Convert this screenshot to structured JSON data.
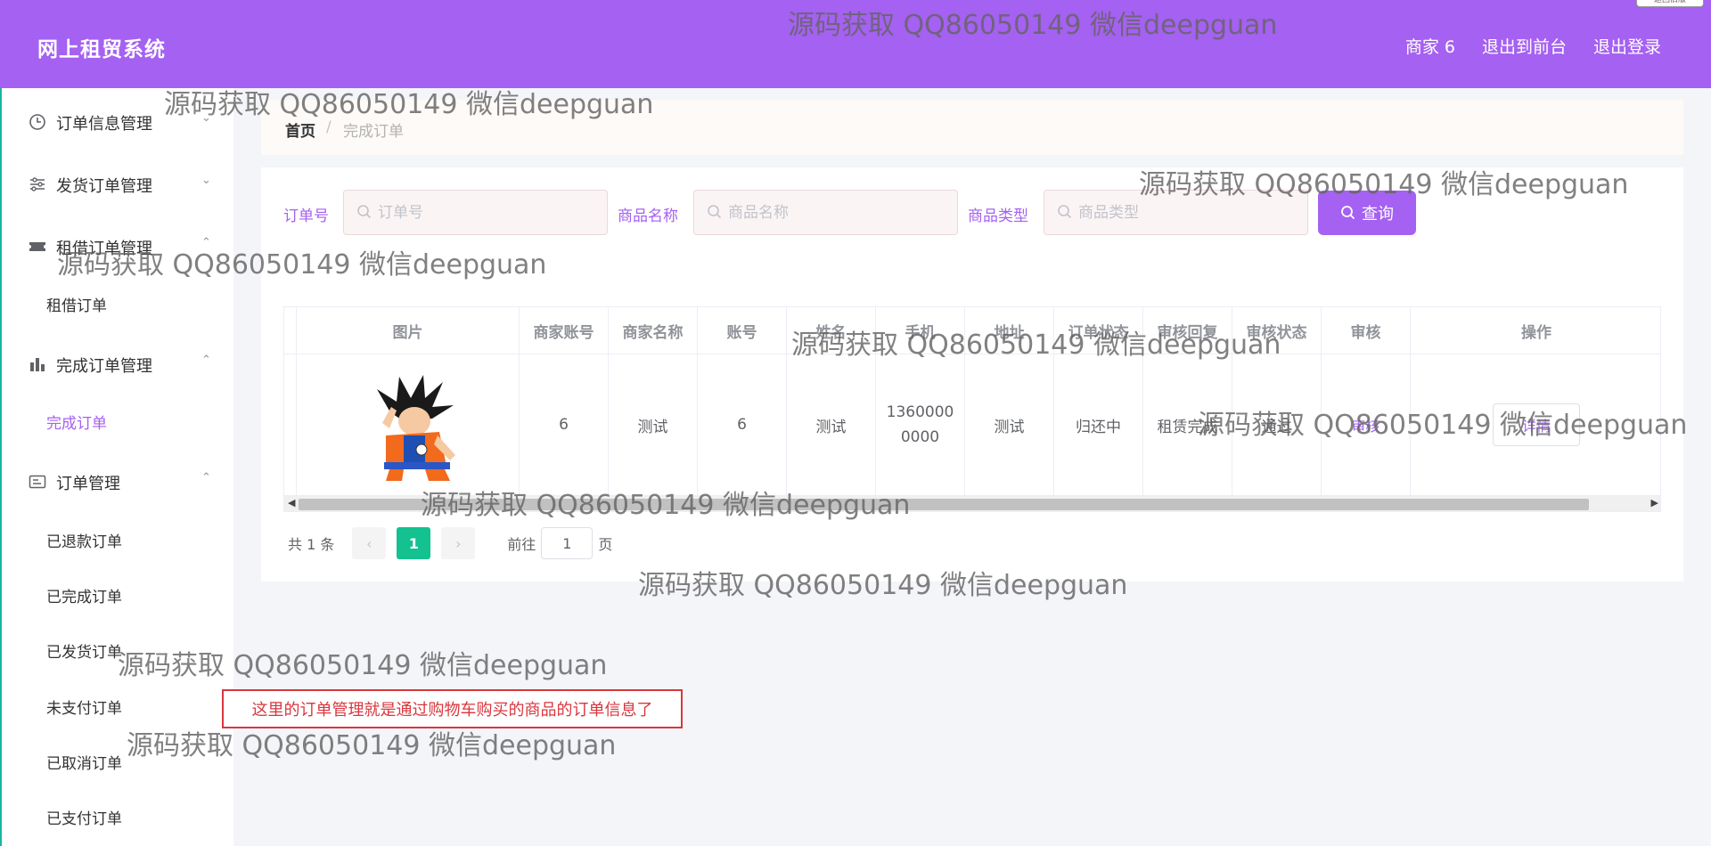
{
  "header": {
    "app_title": "网上租贸系统",
    "nav": [
      "商家 6",
      "退出到前台",
      "退出登录"
    ],
    "corner_label": "返回旧版"
  },
  "sidebar": {
    "groups": [
      {
        "label": "订单信息管理",
        "icon": "clock-icon",
        "chevron": "⌄"
      },
      {
        "label": "发货订单管理",
        "icon": "sliders-icon",
        "chevron": "⌄"
      },
      {
        "label": "租借订单管理",
        "icon": "ticket-icon",
        "chevron": "⌃",
        "items": [
          "租借订单"
        ]
      },
      {
        "label": "完成订单管理",
        "icon": "bar-chart-icon",
        "chevron": "⌃",
        "items": [
          "完成订单"
        ]
      },
      {
        "label": "订单管理",
        "icon": "id-card-icon",
        "chevron": "⌃",
        "items": [
          "已退款订单",
          "已完成订单",
          "已发货订单",
          "未支付订单",
          "已取消订单",
          "已支付订单"
        ]
      }
    ],
    "active_item": "完成订单"
  },
  "breadcrumb": {
    "home": "首页",
    "separator": "/",
    "current": "完成订单"
  },
  "search": {
    "fields": [
      {
        "label": "订单号",
        "placeholder": "订单号",
        "value": ""
      },
      {
        "label": "商品名称",
        "placeholder": "商品名称",
        "value": ""
      },
      {
        "label": "商品类型",
        "placeholder": "商品类型",
        "value": ""
      }
    ],
    "button_label": "查询"
  },
  "table": {
    "columns": [
      "图片",
      "商家账号",
      "商家名称",
      "账号",
      "姓名",
      "手机",
      "地址",
      "订单状态",
      "审核回复",
      "审核状态",
      "审核",
      "操作"
    ],
    "rows": [
      {
        "image": "goku-image",
        "merchant_account": "6",
        "merchant_name": "测试",
        "account": "6",
        "name": "测试",
        "phone": "1360000 0000",
        "address": "测试",
        "order_status": "归还中",
        "audit_reply": "租赁完成",
        "audit_status": "通过",
        "audit": "审核",
        "action": "详情"
      }
    ]
  },
  "pagination": {
    "total": "共 1 条",
    "prev": "‹",
    "page": "1",
    "next": "›",
    "goto_label": "前往",
    "goto_value": "1",
    "page_suffix": "页"
  },
  "note": "这里的订单管理就是通过购物车购买的商品的订单信息了",
  "watermark": "源码获取 QQ86050149 微信deepguan",
  "colors": {
    "accent": "#a561f1",
    "pager_active": "#14c191",
    "note_red": "#d9363e"
  }
}
